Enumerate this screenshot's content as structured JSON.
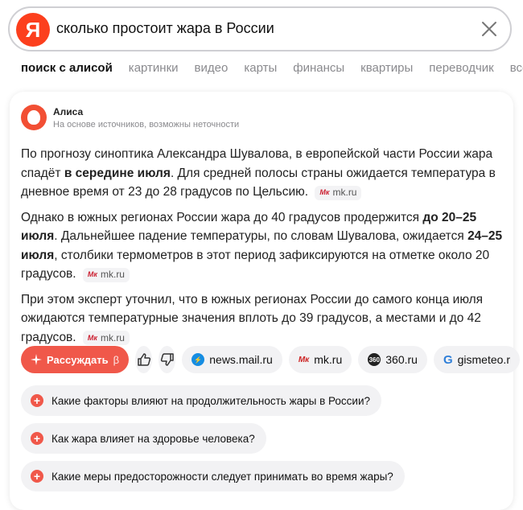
{
  "search": {
    "logo": "Я",
    "query": "сколько простоит жара в России"
  },
  "tabs": [
    {
      "label": "поиск с алисой",
      "active": true
    },
    {
      "label": "картинки",
      "active": false
    },
    {
      "label": "видео",
      "active": false
    },
    {
      "label": "карты",
      "active": false
    },
    {
      "label": "финансы",
      "active": false
    },
    {
      "label": "квартиры",
      "active": false
    },
    {
      "label": "переводчик",
      "active": false
    },
    {
      "label": "все",
      "active": false
    }
  ],
  "alice": {
    "name": "Алиса",
    "subtitle": "На основе источников, возможны неточности"
  },
  "answer": {
    "p1_a": "По прогнозу синоптика Александра Шувалова, в европейской части России жара спадёт ",
    "p1_b": "в середине июля",
    "p1_c": ". Для средней полосы страны ожидается температура в дневное время от 23 до 28 градусов по Цельсию.",
    "p2_a": "Однако в южных регионах России жара до 40 градусов продержится ",
    "p2_b": "до 20–25 июля",
    "p2_c": ". Дальнейшее падение температуры, по словам Шувалова, ожидается ",
    "p2_d": "24–25 июля",
    "p2_e": ", столбики термометров в этот период зафиксируются на отметке около 20 градусов.",
    "p3": "При этом эксперт уточнил, что в южных регионах России до самого конца июля ожидаются температурные значения вплоть до 39 градусов, а местами и до 42 градусов.",
    "source_chip": "mk.ru",
    "source_chip_mark": "Мк"
  },
  "actions": {
    "reason_label": "Рассуждать",
    "reason_beta": "β",
    "sources": [
      {
        "label": "news.mail.ru",
        "icon": "lightning-icon",
        "color": "#168de2"
      },
      {
        "label": "mk.ru",
        "icon": "mk-icon",
        "color": "#c22"
      },
      {
        "label": "360.ru",
        "icon": "360-icon",
        "color": "#222"
      },
      {
        "label": "gismeteo.r",
        "icon": "g-icon",
        "color": "#2f7fd8"
      }
    ]
  },
  "suggestions": [
    "Какие факторы влияют на продолжительность жары в России?",
    "Как жара влияет на здоровье человека?",
    "Какие меры предосторожности следует принимать во время жары?"
  ],
  "colors": {
    "accent": "#f0584a",
    "yandex_red": "#fc3f1d"
  }
}
